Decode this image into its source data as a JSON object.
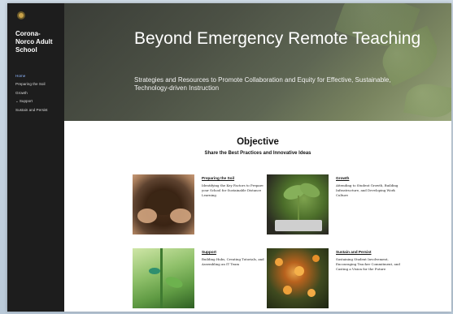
{
  "sidebar": {
    "school_name": "Corona-Norco Adult School",
    "items": [
      {
        "label": "Home",
        "active": true
      },
      {
        "label": "Preparing the Soil",
        "active": false
      },
      {
        "label": "Growth",
        "active": false
      },
      {
        "label": "Support",
        "active": false,
        "expandable": true
      },
      {
        "label": "Sustain and Persist",
        "active": false
      }
    ],
    "colors": {
      "background": "#1d1d1d",
      "active_link": "#8fb7ff"
    }
  },
  "hero": {
    "title": "Beyond Emergency Remote Teaching",
    "subtitle": "Strategies and Resources to Promote Collaboration and Equity for Effective, Sustainable, Technology-driven Instruction"
  },
  "objective": {
    "title": "Objective",
    "subtitle": "Share the Best Practices and Innovative Ideas"
  },
  "cards": [
    {
      "title": "Preparing the Soil",
      "description": "Identifying the Key Factors to Prepare your School for Sustainable Distance Learning",
      "image_icon": "soil-in-hands-photo"
    },
    {
      "title": "Growth",
      "description": "Attending to Student Growth, Building Infrastructure, and Developing Work Culture",
      "image_icon": "seedling-photo"
    },
    {
      "title": "Support",
      "description": "Building Hubs, Creating Tutorials, and Assembling an IT Team",
      "image_icon": "staked-plant-photo"
    },
    {
      "title": "Sustain and Persist",
      "description": "Sustaining Student Involvement, Encouraging Teacher Commitment, and Casting a Vision for the Future",
      "image_icon": "citrus-tree-photo"
    }
  ]
}
